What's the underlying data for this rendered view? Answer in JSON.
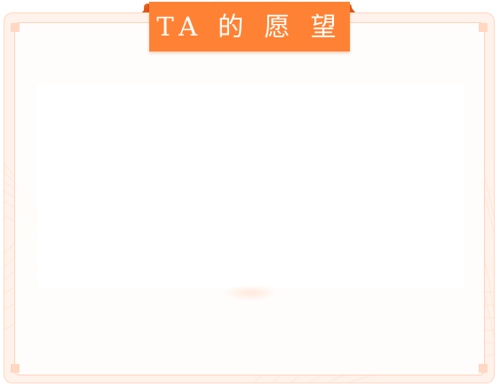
{
  "header": {
    "title": "TA 的 愿 望"
  },
  "colors": {
    "accent": "#ff8234",
    "accent_dark": "#e86524",
    "frame_fill": "#fff2ea",
    "frame_border": "#ffd7c2",
    "content_fill": "#ffffff"
  }
}
